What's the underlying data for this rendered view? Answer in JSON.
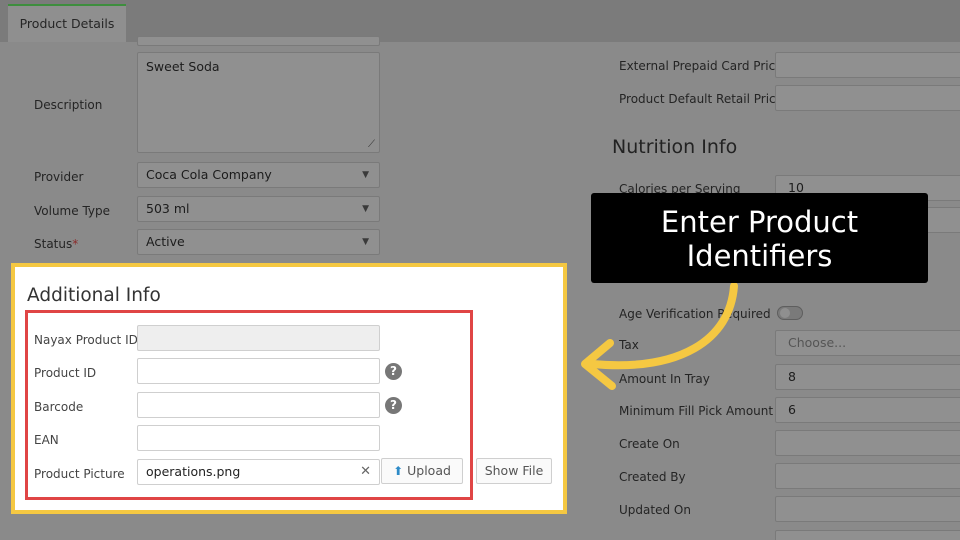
{
  "tab": {
    "label": "Product Details"
  },
  "left": {
    "description": {
      "label": "Description",
      "value": "Sweet Soda"
    },
    "provider": {
      "label": "Provider",
      "value": "Coca Cola Company"
    },
    "volume_type": {
      "label": "Volume Type",
      "value": "503 ml"
    },
    "status": {
      "label": "Status",
      "required_mark": "*",
      "value": "Active"
    }
  },
  "additional_info": {
    "title": "Additional Info",
    "nayax_product_id": {
      "label": "Nayax Product ID",
      "value": ""
    },
    "product_id": {
      "label": "Product ID",
      "value": ""
    },
    "barcode": {
      "label": "Barcode",
      "value": ""
    },
    "ean": {
      "label": "EAN",
      "value": ""
    },
    "product_picture": {
      "label": "Product Picture",
      "value": "operations.png",
      "upload_label": "Upload",
      "show_file_label": "Show File"
    },
    "help_glyph": "?",
    "clear_glyph": "✕"
  },
  "right": {
    "external_prepaid_card_price": {
      "label": "External Prepaid Card Price",
      "value": ""
    },
    "product_default_retail_price": {
      "label": "Product Default Retail Price",
      "value": ""
    },
    "nutrition_title": "Nutrition Info",
    "calories_per_serving": {
      "label": "Calories per Serving",
      "value": "10"
    },
    "age_verification": {
      "label": "Age Verification Required"
    },
    "tax": {
      "label": "Tax",
      "placeholder": "Choose..."
    },
    "amount_in_tray": {
      "label": "Amount In Tray",
      "value": "8"
    },
    "minimum_fill_pick_amount": {
      "label": "Minimum Fill Pick Amount",
      "value": "6"
    },
    "create_on": {
      "label": "Create On",
      "value": ""
    },
    "created_by": {
      "label": "Created By",
      "value": ""
    },
    "updated_on": {
      "label": "Updated On",
      "value": ""
    }
  },
  "callout": {
    "line1": "Enter Product",
    "line2": "Identifiers"
  },
  "colors": {
    "highlight_yellow": "#f5c842",
    "highlight_red": "#e04545",
    "callout_bg": "#000000",
    "tab_accent": "#3e8e3e"
  },
  "icons": {
    "upload": "upload-icon",
    "help": "help-icon",
    "clear": "close-icon",
    "caret": "chevron-down-icon",
    "resize": "resize-handle-icon"
  }
}
